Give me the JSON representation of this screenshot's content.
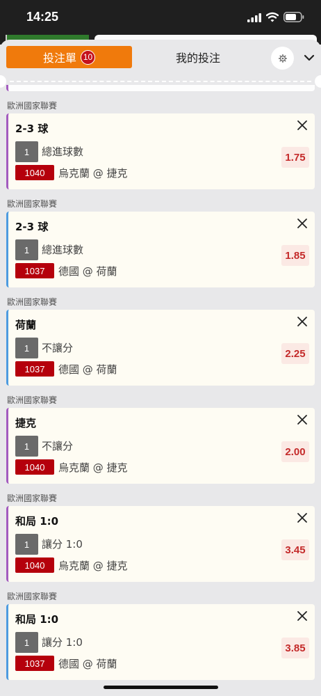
{
  "status_bar": {
    "time": "14:25"
  },
  "tabs": {
    "active_label": "投注單",
    "active_count": "10",
    "inactive_label": "我的投注"
  },
  "colors": {
    "accent": "#f07a0c",
    "badge": "#c5121b",
    "match_id_bg": "#b5000c",
    "odds_text": "#c42a2a",
    "purple_stripe": "#a35bbf",
    "blue_stripe": "#4d9be0"
  },
  "icons": [
    "signal-icon",
    "wifi-icon",
    "battery-icon",
    "gear-icon",
    "chevron-down-icon",
    "close-icon"
  ],
  "bets": [
    {
      "league": "歐洲國家聯賽",
      "selection": "2-3 球",
      "quantity": "1",
      "market": "總進球數",
      "match_id": "1040",
      "match": "烏克蘭 @ 捷克",
      "odds": "1.75",
      "stripe": "purple"
    },
    {
      "league": "歐洲國家聯賽",
      "selection": "2-3 球",
      "quantity": "1",
      "market": "總進球數",
      "match_id": "1037",
      "match": "德國 @ 荷蘭",
      "odds": "1.85",
      "stripe": "blue"
    },
    {
      "league": "歐洲國家聯賽",
      "selection": "荷蘭",
      "quantity": "1",
      "market": "不讓分",
      "match_id": "1037",
      "match": "德國 @ 荷蘭",
      "odds": "2.25",
      "stripe": "blue"
    },
    {
      "league": "歐洲國家聯賽",
      "selection": "捷克",
      "quantity": "1",
      "market": "不讓分",
      "match_id": "1040",
      "match": "烏克蘭 @ 捷克",
      "odds": "2.00",
      "stripe": "purple"
    },
    {
      "league": "歐洲國家聯賽",
      "selection": "和局 1:0",
      "quantity": "1",
      "market": "讓分 1:0",
      "match_id": "1040",
      "match": "烏克蘭 @ 捷克",
      "odds": "3.45",
      "stripe": "purple"
    },
    {
      "league": "歐洲國家聯賽",
      "selection": "和局 1:0",
      "quantity": "1",
      "market": "讓分 1:0",
      "match_id": "1037",
      "match": "德國 @ 荷蘭",
      "odds": "3.85",
      "stripe": "blue"
    }
  ]
}
